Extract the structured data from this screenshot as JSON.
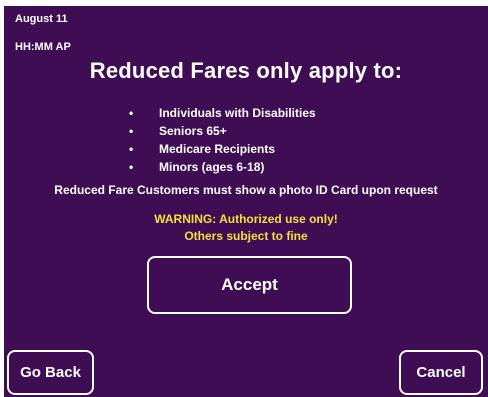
{
  "header": {
    "date": "August 11",
    "time": "HH:MM AP"
  },
  "main": {
    "title": "Reduced Fares only apply to:",
    "bullet_glyph": "•",
    "eligibility": [
      "Individuals with Disabilities",
      "Seniors 65+",
      "Medicare Recipients",
      "Minors (ages 6-18)"
    ],
    "id_notice": "Reduced Fare Customers must show a photo ID Card upon request",
    "warning_line1": "WARNING: Authorized use only!",
    "warning_line2": "Others subject to fine"
  },
  "buttons": {
    "accept": "Accept",
    "go_back": "Go Back",
    "cancel": "Cancel"
  },
  "colors": {
    "background": "#3e0d53",
    "text": "#ffffff",
    "warning": "#f2e13a",
    "button_border": "#ffffff"
  }
}
